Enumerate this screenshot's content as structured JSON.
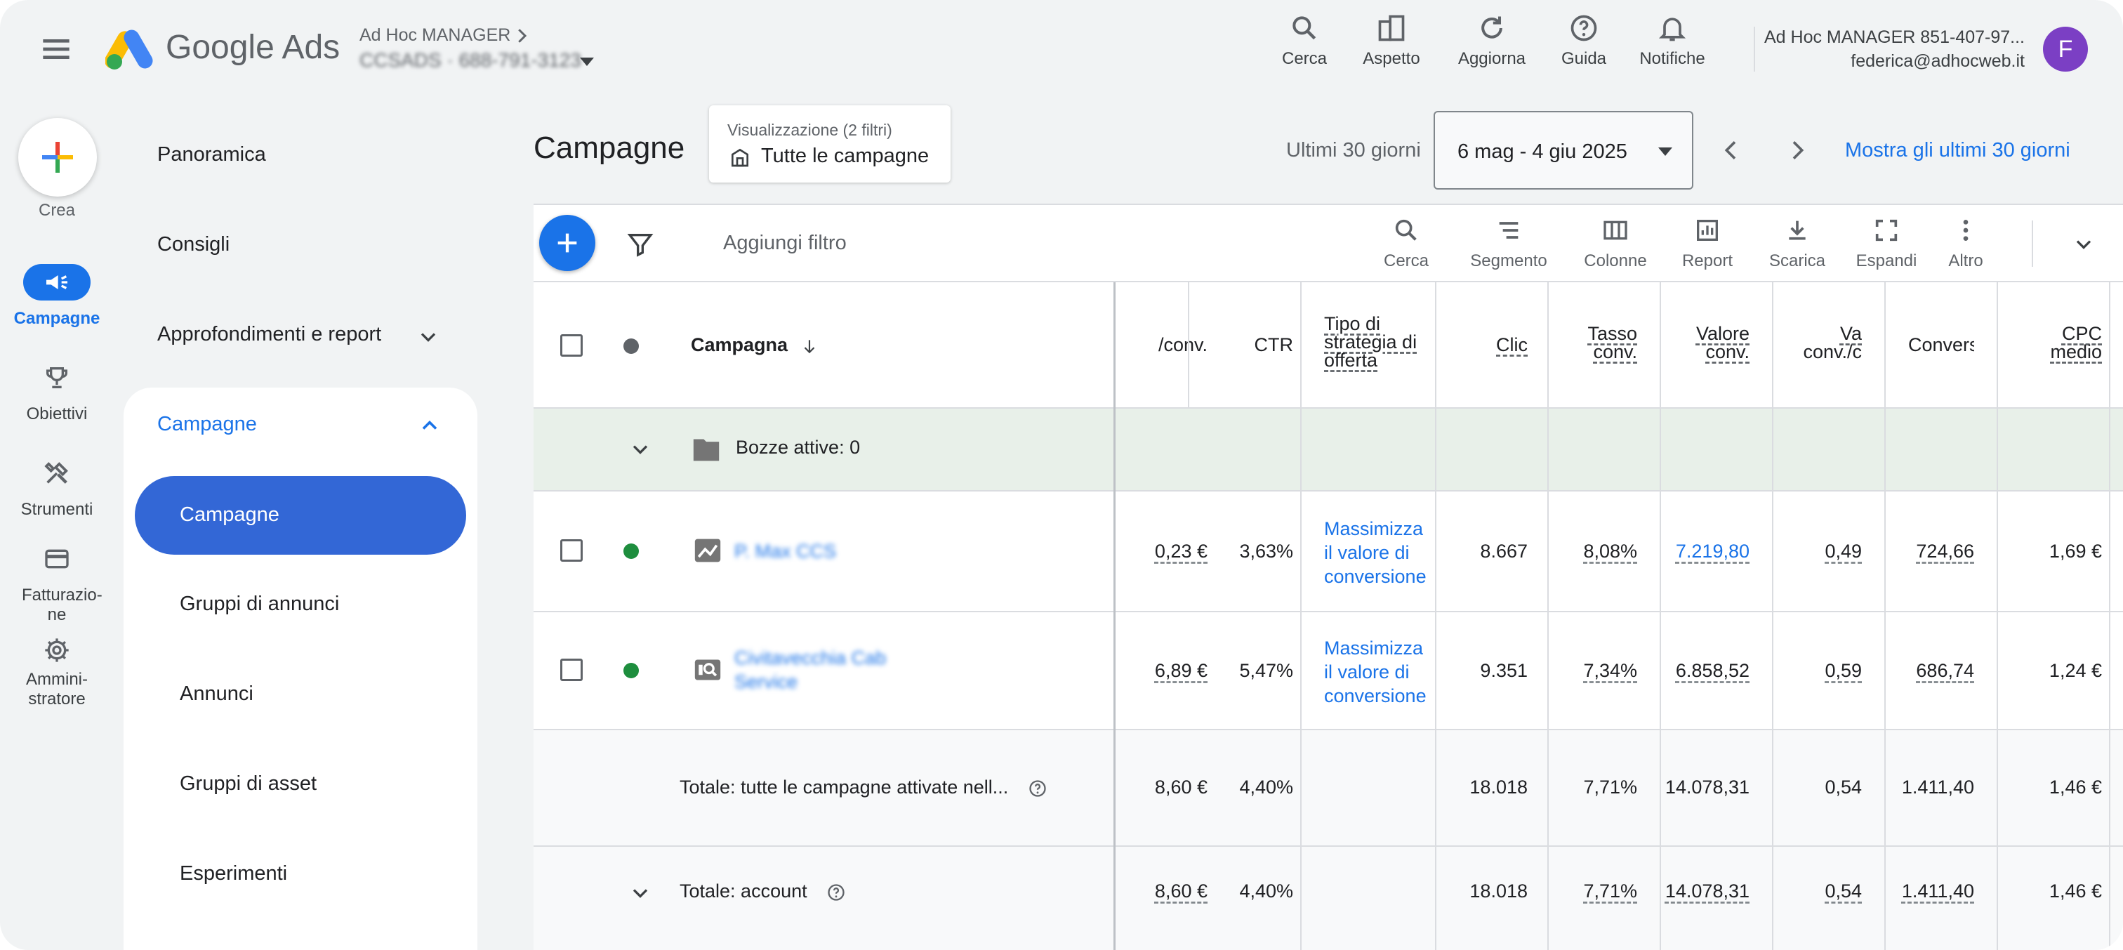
{
  "header": {
    "app_name": "Google Ads",
    "account_name": "Ad Hoc MANAGER",
    "account_sub": "CCSADS  ·  688-791-3123",
    "toolbar": [
      {
        "label": "Cerca",
        "icon": "search-icon"
      },
      {
        "label": "Aspetto",
        "icon": "appearance-icon"
      },
      {
        "label": "Aggiorna",
        "icon": "refresh-icon"
      },
      {
        "label": "Guida",
        "icon": "help-icon"
      },
      {
        "label": "Notifiche",
        "icon": "bell-icon"
      }
    ],
    "user_account": "Ad Hoc MANAGER 851-407-97...",
    "user_email": "federica@adhocweb.it",
    "avatar_letter": "F"
  },
  "rail": {
    "create_label": "Crea",
    "items": [
      {
        "label": "Campagne",
        "icon": "megaphone-icon",
        "active": true
      },
      {
        "label": "Obiettivi",
        "icon": "trophy-icon"
      },
      {
        "label": "Strumenti",
        "icon": "tools-icon"
      },
      {
        "label": "Fatturazio-ne",
        "icon": "credit-card-icon"
      },
      {
        "label": "Ammini-stratore",
        "icon": "settings-icon"
      }
    ]
  },
  "nav": {
    "top_items": [
      "Panoramica",
      "Consigli",
      "Approfondimenti e report"
    ],
    "section_label": "Campagne",
    "active_item": "Campagne",
    "sub_items": [
      "Gruppi di annunci",
      "Annunci",
      "Gruppi di asset",
      "Esperimenti"
    ]
  },
  "main": {
    "title": "Campagne",
    "view_label": "Visualizzazione (2 filtri)",
    "view_value": "Tutte le campagne",
    "range_label": "Ultimi 30 giorni",
    "date_range": "6 mag - 4 giu 2025",
    "show_last_link": "Mostra gli ultimi 30 giorni"
  },
  "table_toolbar": {
    "add_filter": "Aggiungi filtro",
    "items": [
      {
        "label": "Cerca",
        "icon": "search-icon"
      },
      {
        "label": "Segmento",
        "icon": "segment-icon"
      },
      {
        "label": "Colonne",
        "icon": "columns-icon"
      },
      {
        "label": "Report",
        "icon": "report-icon"
      },
      {
        "label": "Scarica",
        "icon": "download-icon"
      },
      {
        "label": "Espandi",
        "icon": "expand-icon"
      },
      {
        "label": "Altro",
        "icon": "more-vert-icon"
      }
    ]
  },
  "table": {
    "headers": {
      "campaign": "Campagna",
      "cost_conv": "/conv.",
      "ctr": "CTR",
      "strategy": "Tipo di strategia di offerta",
      "clicks": "Clic",
      "conv_rate": "Tasso conv.",
      "conv_value": "Valore conv.",
      "value_conv": "Va conv./c",
      "conversions": "Convers",
      "avg_cpc": "CPC medio"
    },
    "draft_row": "Bozze attive: 0",
    "rows": [
      {
        "name": "P. Max CCS",
        "cost_conv": "0,23 €",
        "ctr": "3,63%",
        "strategy": "Massimizza il valore di conversione",
        "clicks": "8.667",
        "conv_rate": "8,08%",
        "conv_value": "7.219,80",
        "value_conv": "0,49",
        "conversions": "724,66",
        "avg_cpc": "1,69 €"
      },
      {
        "name": "Civitavecchia Cab Service",
        "cost_conv": "6,89 €",
        "ctr": "5,47%",
        "strategy": "Massimizza il valore di conversione",
        "clicks": "9.351",
        "conv_rate": "7,34%",
        "conv_value": "6.858,52",
        "value_conv": "0,59",
        "conversions": "686,74",
        "avg_cpc": "1,24 €"
      }
    ],
    "totals": [
      {
        "label": "Totale: tutte le campagne attivate nell...",
        "cost_conv": "8,60 €",
        "ctr": "4,40%",
        "clicks": "18.018",
        "conv_rate": "7,71%",
        "conv_value": "14.078,31",
        "value_conv": "0,54",
        "conversions": "1.411,40",
        "avg_cpc": "1,46 €"
      },
      {
        "label": "Totale: account",
        "cost_conv": "8,60 €",
        "ctr": "4,40%",
        "clicks": "18.018",
        "conv_rate": "7,71%",
        "conv_value": "14.078,31",
        "value_conv": "0,54",
        "conversions": "1.411,40",
        "avg_cpc": "1,46 €"
      }
    ]
  },
  "colors": {
    "accent": "#1a73e8",
    "active_status": "#1e8e3e",
    "draft_bg": "#e8f0e9",
    "avatar": "#7b3fc4"
  }
}
